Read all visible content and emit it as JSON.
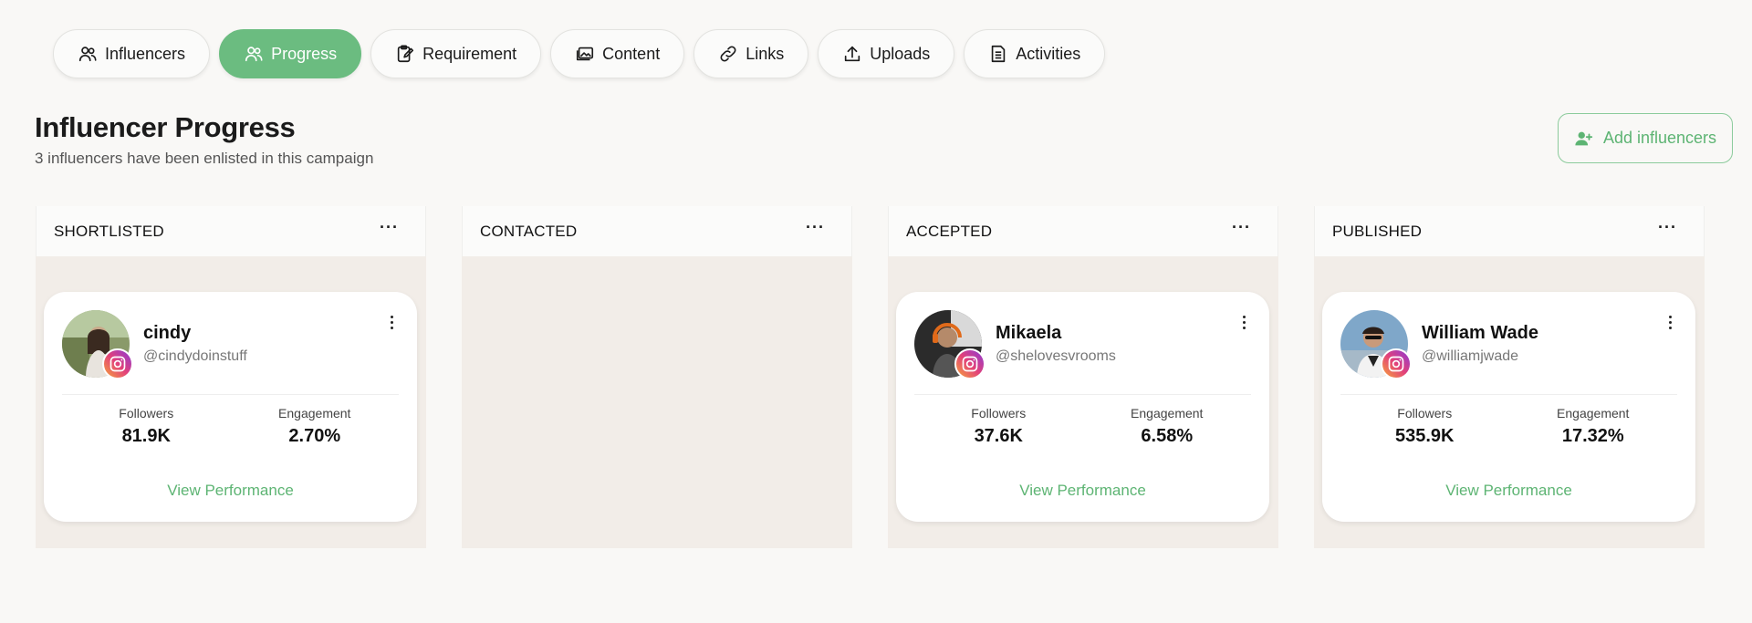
{
  "tabs": [
    {
      "label": "Influencers",
      "icon": "users-icon"
    },
    {
      "label": "Progress",
      "icon": "users-icon",
      "active": true
    },
    {
      "label": "Requirement",
      "icon": "clipboard-edit-icon"
    },
    {
      "label": "Content",
      "icon": "images-icon"
    },
    {
      "label": "Links",
      "icon": "link-icon"
    },
    {
      "label": "Uploads",
      "icon": "upload-icon"
    },
    {
      "label": "Activities",
      "icon": "document-icon"
    }
  ],
  "header": {
    "title": "Influencer Progress",
    "subtitle": "3 influencers have been enlisted in this campaign",
    "add_button": "Add influencers"
  },
  "columns": [
    {
      "title": "SHORTLISTED",
      "menu": "···",
      "card": {
        "name": "cindy",
        "handle": "@cindydoinstuff",
        "followers_label": "Followers",
        "followers": "81.9K",
        "engagement_label": "Engagement",
        "engagement": "2.70%",
        "link": "View Performance"
      }
    },
    {
      "title": "CONTACTED",
      "menu": "···"
    },
    {
      "title": "ACCEPTED",
      "menu": "···",
      "card": {
        "name": "Mikaela",
        "handle": "@shelovesvrooms",
        "followers_label": "Followers",
        "followers": "37.6K",
        "engagement_label": "Engagement",
        "engagement": "6.58%",
        "link": "View Performance"
      }
    },
    {
      "title": "PUBLISHED",
      "menu": "···",
      "card": {
        "name": "William Wade",
        "handle": "@williamjwade",
        "followers_label": "Followers",
        "followers": "535.9K",
        "engagement_label": "Engagement",
        "engagement": "17.32%",
        "link": "View Performance"
      }
    }
  ],
  "colors": {
    "accent": "#6bbc80",
    "column_bg": "#f2ede8",
    "page_bg": "#f9f8f6"
  }
}
